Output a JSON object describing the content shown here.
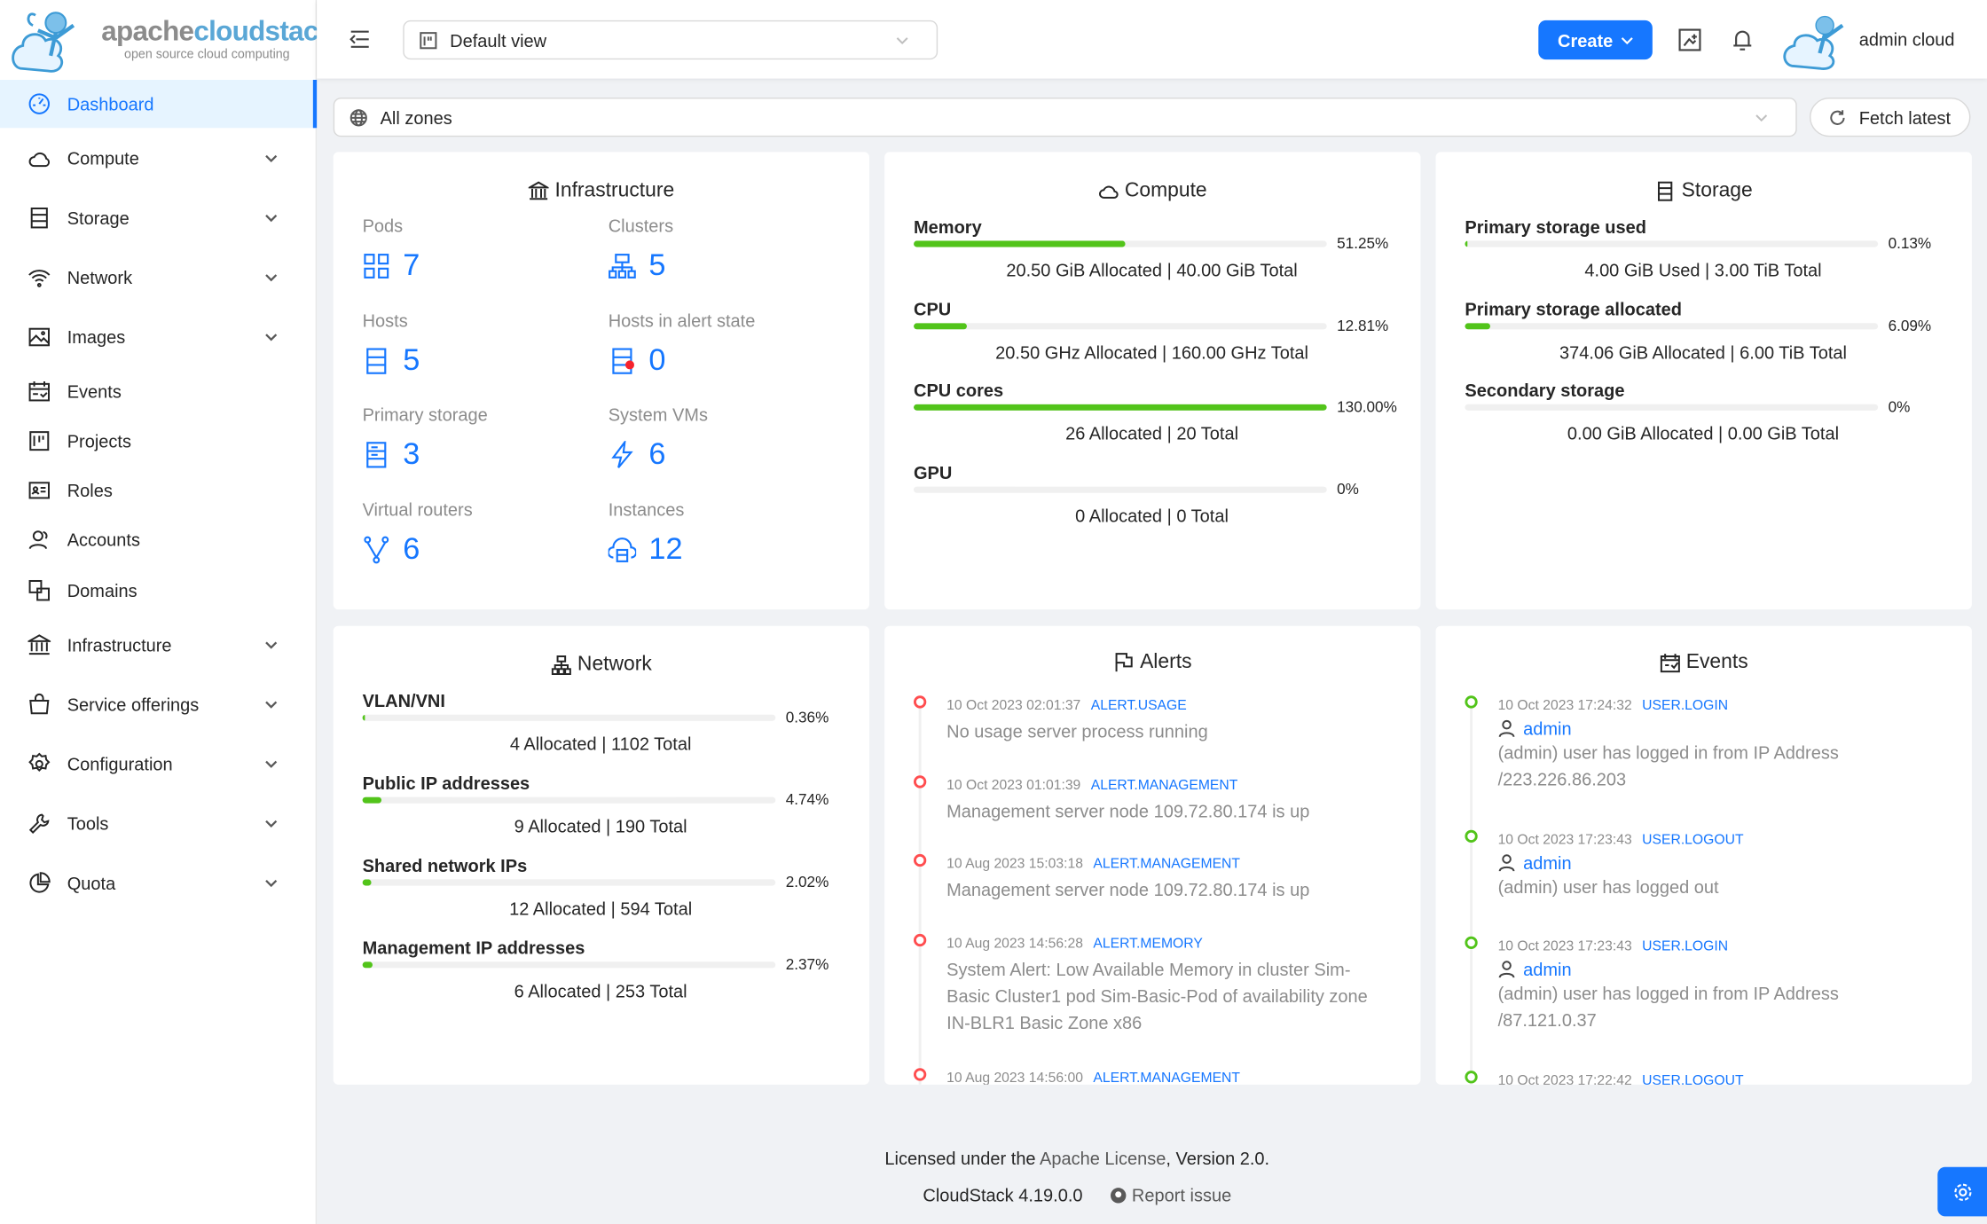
{
  "logo": {
    "brand_a": "apache",
    "brand_b": "cloudstack",
    "tagline": "open source cloud computing"
  },
  "sidebar": {
    "items": [
      {
        "label": "Dashboard",
        "icon": "dashboard-icon",
        "active": true,
        "expandable": false
      },
      {
        "label": "Compute",
        "icon": "cloud-icon",
        "expandable": true
      },
      {
        "label": "Storage",
        "icon": "storage-icon",
        "expandable": true
      },
      {
        "label": "Network",
        "icon": "wifi-icon",
        "expandable": true
      },
      {
        "label": "Images",
        "icon": "picture-icon",
        "expandable": true
      },
      {
        "label": "Events",
        "icon": "schedule-icon",
        "expandable": false
      },
      {
        "label": "Projects",
        "icon": "project-icon",
        "expandable": false
      },
      {
        "label": "Roles",
        "icon": "idcard-icon",
        "expandable": false
      },
      {
        "label": "Accounts",
        "icon": "team-icon",
        "expandable": false
      },
      {
        "label": "Domains",
        "icon": "block-icon",
        "expandable": false
      },
      {
        "label": "Infrastructure",
        "icon": "bank-icon",
        "expandable": true
      },
      {
        "label": "Service offerings",
        "icon": "shopping-icon",
        "expandable": true
      },
      {
        "label": "Configuration",
        "icon": "setting-icon",
        "expandable": true
      },
      {
        "label": "Tools",
        "icon": "tool-icon",
        "expandable": true
      },
      {
        "label": "Quota",
        "icon": "pie-chart-icon",
        "expandable": true
      }
    ]
  },
  "header": {
    "view_select": "Default view",
    "create_label": "Create",
    "user_name": "admin cloud"
  },
  "zone_select": "All zones",
  "fetch_latest": "Fetch latest",
  "accent": "#1677ff",
  "bar_color": "#52c41a",
  "alert_color": "#ff4d4f",
  "infrastructure": {
    "title": "Infrastructure",
    "items": [
      {
        "label": "Pods",
        "value": "7",
        "icon": "appstore-icon"
      },
      {
        "label": "Clusters",
        "value": "5",
        "icon": "cluster-icon"
      },
      {
        "label": "Hosts",
        "value": "5",
        "icon": "database-icon"
      },
      {
        "label": "Hosts in alert state",
        "value": "0",
        "icon": "database-alert-icon"
      },
      {
        "label": "Primary storage",
        "value": "3",
        "icon": "hdd-icon"
      },
      {
        "label": "System VMs",
        "value": "6",
        "icon": "thunderbolt-icon"
      },
      {
        "label": "Virtual routers",
        "value": "6",
        "icon": "fork-icon"
      },
      {
        "label": "Instances",
        "value": "12",
        "icon": "cloud-server-icon"
      }
    ]
  },
  "compute": {
    "title": "Compute",
    "bars": [
      {
        "label": "Memory",
        "percent": 51.25,
        "pct_text": "51.25%",
        "summary": "20.50 GiB Allocated | 40.00 GiB Total"
      },
      {
        "label": "CPU",
        "percent": 12.81,
        "pct_text": "12.81%",
        "summary": "20.50 GHz Allocated | 160.00 GHz Total"
      },
      {
        "label": "CPU cores",
        "percent": 130,
        "pct_text": "130.00%",
        "summary": "26 Allocated | 20 Total"
      },
      {
        "label": "GPU",
        "percent": 0,
        "pct_text": "0%",
        "summary": "0 Allocated | 0 Total"
      }
    ]
  },
  "storage": {
    "title": "Storage",
    "bars": [
      {
        "label": "Primary storage used",
        "percent": 0.13,
        "pct_text": "0.13%",
        "summary": "4.00 GiB Used | 3.00 TiB Total"
      },
      {
        "label": "Primary storage allocated",
        "percent": 6.09,
        "pct_text": "6.09%",
        "summary": "374.06 GiB Allocated | 6.00 TiB Total"
      },
      {
        "label": "Secondary storage",
        "percent": 0,
        "pct_text": "0%",
        "summary": "0.00 GiB Allocated | 0.00 GiB Total"
      }
    ]
  },
  "network": {
    "title": "Network",
    "bars": [
      {
        "label": "VLAN/VNI",
        "percent": 0.36,
        "pct_text": "0.36%",
        "summary": "4 Allocated | 1102 Total"
      },
      {
        "label": "Public IP addresses",
        "percent": 4.74,
        "pct_text": "4.74%",
        "summary": "9 Allocated | 190 Total"
      },
      {
        "label": "Shared network IPs",
        "percent": 2.02,
        "pct_text": "2.02%",
        "summary": "12 Allocated | 594 Total"
      },
      {
        "label": "Management IP addresses",
        "percent": 2.37,
        "pct_text": "2.37%",
        "summary": "6 Allocated | 253 Total"
      }
    ]
  },
  "alerts": {
    "title": "Alerts",
    "items": [
      {
        "time": "10 Oct 2023 02:01:37",
        "type": "ALERT.USAGE",
        "desc": "No usage server process running"
      },
      {
        "time": "10 Oct 2023 01:01:39",
        "type": "ALERT.MANAGEMENT",
        "desc": "Management server node 109.72.80.174 is up"
      },
      {
        "time": "10 Aug 2023 15:03:18",
        "type": "ALERT.MANAGEMENT",
        "desc": "Management server node 109.72.80.174 is up"
      },
      {
        "time": "10 Aug 2023 14:56:28",
        "type": "ALERT.MEMORY",
        "desc": "System Alert: Low Available Memory in cluster Sim-Basic Cluster1 pod Sim-Basic-Pod of availability zone IN-BLR1 Basic Zone x86"
      },
      {
        "time": "10 Aug 2023 14:56:00",
        "type": "ALERT.MANAGEMENT",
        "desc": ""
      }
    ]
  },
  "events": {
    "title": "Events",
    "items": [
      {
        "time": "10 Oct 2023 17:24:32",
        "type": "USER.LOGIN",
        "user": "admin",
        "desc": "(admin) user has logged in from IP Address /223.226.86.203"
      },
      {
        "time": "10 Oct 2023 17:23:43",
        "type": "USER.LOGOUT",
        "user": "admin",
        "desc": "(admin) user has logged out"
      },
      {
        "time": "10 Oct 2023 17:23:43",
        "type": "USER.LOGIN",
        "user": "admin",
        "desc": "(admin) user has logged in from IP Address /87.121.0.37"
      },
      {
        "time": "10 Oct 2023 17:22:42",
        "type": "USER.LOGOUT",
        "user": "",
        "desc": ""
      }
    ]
  },
  "footer": {
    "license_pre": "Licensed under the ",
    "license_link": "Apache License",
    "license_post": ", Version 2.0.",
    "version": "CloudStack 4.19.0.0",
    "report_issue": "Report issue"
  }
}
